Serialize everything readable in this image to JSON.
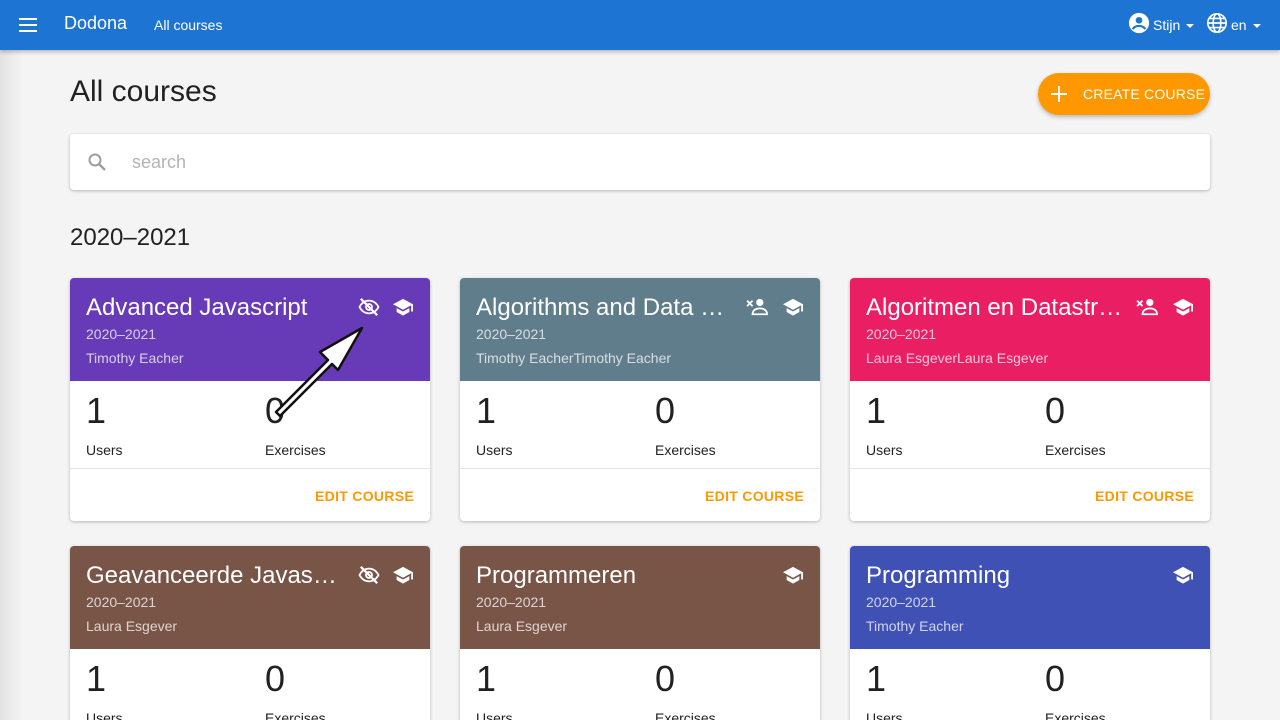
{
  "colors": {
    "topbar": "#1e74d2",
    "accent": "#ff9800",
    "purple": "#673ab7",
    "bluegrey": "#607d8b",
    "pink": "#e91e63",
    "brown": "#795548",
    "indigo": "#3f51b5"
  },
  "topbar": {
    "menu_icon": "menu-icon",
    "brand": "Dodona",
    "nav_link": "All courses",
    "user_name": "Stijn",
    "user_icon": "account-circle-icon",
    "language": "en",
    "language_icon": "globe-icon"
  },
  "page": {
    "title": "All courses",
    "create_button": "CREATE COURSE",
    "search_placeholder": "search",
    "year_heading": "2020–2021"
  },
  "courses": [
    {
      "name": "Advanced Javascript",
      "year": "2020–2021",
      "teachers": "Timothy Eacher",
      "users": "1",
      "users_label": "Users",
      "exercises": "0",
      "exercises_label": "Exercises",
      "edit": "EDIT COURSE",
      "color": "purple",
      "icons": [
        "visibility-off-icon",
        "school-icon"
      ]
    },
    {
      "name": "Algorithms and Data Structures",
      "year": "2020–2021",
      "teachers": "Timothy EacherTimothy Eacher",
      "users": "1",
      "users_label": "Users",
      "exercises": "0",
      "exercises_label": "Exercises",
      "edit": "EDIT COURSE",
      "color": "bluegrey",
      "icons": [
        "person-remove-icon",
        "school-icon"
      ]
    },
    {
      "name": "Algoritmen en Datastructuren",
      "year": "2020–2021",
      "teachers": "Laura EsgeverLaura Esgever",
      "users": "1",
      "users_label": "Users",
      "exercises": "0",
      "exercises_label": "Exercises",
      "edit": "EDIT COURSE",
      "color": "pink",
      "icons": [
        "person-remove-icon",
        "school-icon"
      ]
    },
    {
      "name": "Geavanceerde Javascript",
      "year": "2020–2021",
      "teachers": "Laura Esgever",
      "users": "1",
      "users_label": "Users",
      "exercises": "0",
      "exercises_label": "Exercises",
      "color": "brown",
      "icons": [
        "visibility-off-icon",
        "school-icon"
      ]
    },
    {
      "name": "Programmeren",
      "year": "2020–2021",
      "teachers": "Laura Esgever",
      "users": "1",
      "users_label": "Users",
      "exercises": "0",
      "exercises_label": "Exercises",
      "color": "brown",
      "icons": [
        "school-icon"
      ]
    },
    {
      "name": "Programming",
      "year": "2020–2021",
      "teachers": "Timothy Eacher",
      "users": "1",
      "users_label": "Users",
      "exercises": "0",
      "exercises_label": "Exercises",
      "color": "indigo",
      "icons": [
        "school-icon"
      ]
    }
  ]
}
